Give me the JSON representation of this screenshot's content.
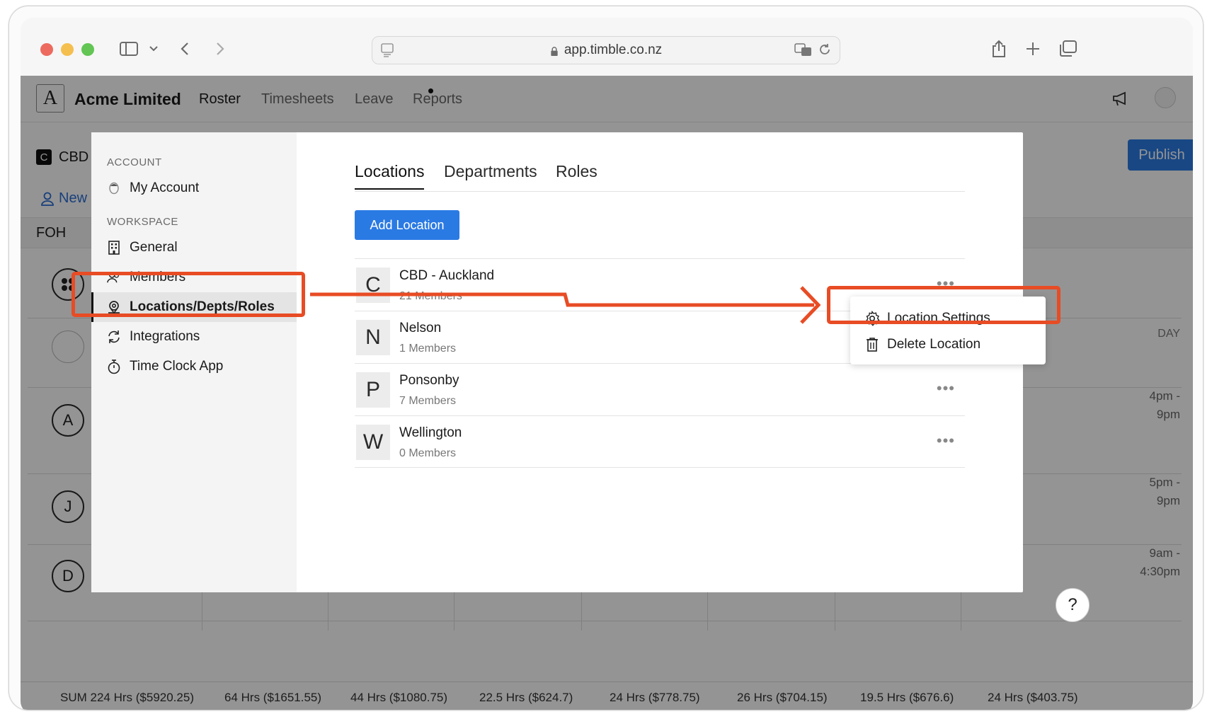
{
  "browser": {
    "url": "app.timble.co.nz"
  },
  "nav": {
    "logo_letter": "A",
    "company": "Acme Limited",
    "links": [
      "Roster",
      "Timesheets",
      "Leave",
      "Reports"
    ]
  },
  "roster": {
    "location_badge": "C",
    "location_label": "CBD -",
    "new_label": "New M",
    "publish_label": "Publish",
    "group_label": "FOH",
    "day_header": "DAY",
    "avatars": [
      "A",
      "J",
      "D"
    ],
    "shift_times": [
      {
        "line1": "4pm -",
        "line2": "9pm"
      },
      {
        "line1": "5pm -",
        "line2": "9pm"
      },
      {
        "line1": "9am -",
        "line2": "4:30pm"
      }
    ],
    "sums": [
      "SUM 224 Hrs ($5920.25)",
      "64 Hrs ($1651.55)",
      "44 Hrs ($1080.75)",
      "22.5 Hrs ($624.7)",
      "24 Hrs ($778.75)",
      "26 Hrs ($704.15)",
      "19.5 Hrs ($676.6)",
      "24 Hrs ($403.75)"
    ],
    "help_label": "?"
  },
  "settings": {
    "account_heading": "ACCOUNT",
    "workspace_heading": "WORKSPACE",
    "account_items": [
      {
        "label": "My Account",
        "icon": "user-icon"
      }
    ],
    "workspace_items": [
      {
        "label": "General",
        "icon": "building-icon"
      },
      {
        "label": "Members",
        "icon": "members-icon"
      },
      {
        "label": "Locations/Depts/Roles",
        "icon": "location-pin-icon"
      },
      {
        "label": "Integrations",
        "icon": "sync-icon"
      },
      {
        "label": "Time Clock App",
        "icon": "stopwatch-icon"
      }
    ],
    "active_item": "Locations/Depts/Roles",
    "tabs": [
      "Locations",
      "Departments",
      "Roles"
    ],
    "active_tab": "Locations",
    "add_button": "Add Location",
    "locations": [
      {
        "letter": "C",
        "name": "CBD - Auckland",
        "members": "21 Members"
      },
      {
        "letter": "N",
        "name": "Nelson",
        "members": "1 Members"
      },
      {
        "letter": "P",
        "name": "Ponsonby",
        "members": "7 Members"
      },
      {
        "letter": "W",
        "name": "Wellington",
        "members": "0 Members"
      }
    ],
    "menu": {
      "settings": "Location Settings",
      "delete": "Delete Location"
    }
  },
  "colors": {
    "accent": "#2a7ae4",
    "annotation": "#e84c25"
  }
}
